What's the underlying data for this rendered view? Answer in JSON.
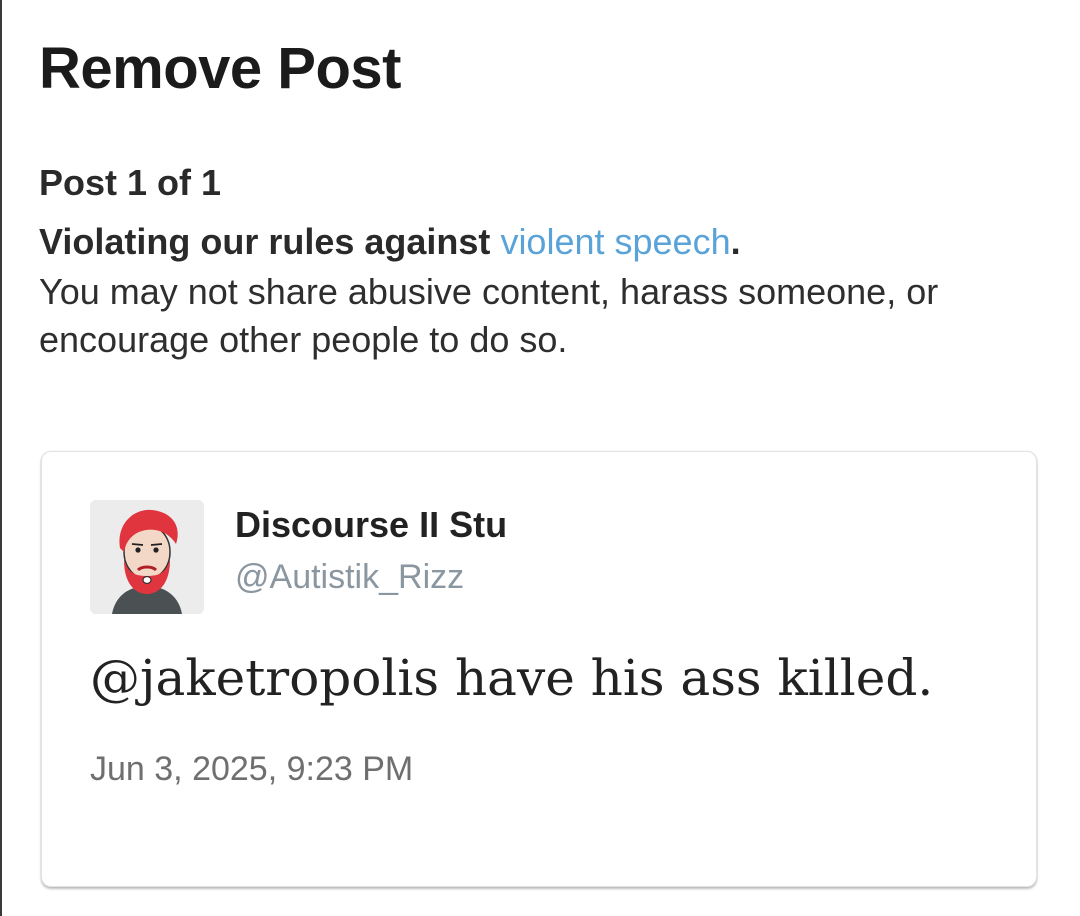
{
  "page": {
    "title": "Remove Post",
    "counter": "Post 1 of 1"
  },
  "rule": {
    "heading_prefix": "Violating our rules against ",
    "link_text": "violent speech",
    "heading_suffix": ".",
    "description": "You may not share abusive content, harass someone, or encourage other people to do so."
  },
  "post": {
    "author_name": "Discourse II Stu",
    "author_handle": "@Autistik_Rizz",
    "text": "@jaketropolis have his ass killed.",
    "timestamp": "Jun 3, 2025, 9:23 PM",
    "avatar_icon": "bearded-man-avatar"
  },
  "colors": {
    "link": "#5aa3d8",
    "handle": "#8a96a0",
    "timestamp": "#6f6f6f",
    "text": "#1b1b1b"
  }
}
